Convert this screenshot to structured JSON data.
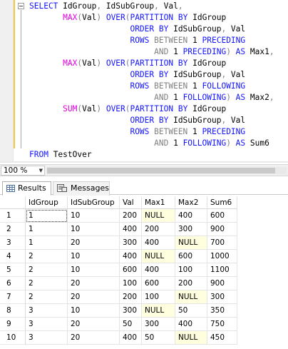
{
  "editor": {
    "lines": [
      [
        {
          "t": "SELECT ",
          "c": "kw"
        },
        {
          "t": "IdGroup",
          "c": "id"
        },
        {
          "t": ", ",
          "c": "op"
        },
        {
          "t": "IdSubGroup",
          "c": "id"
        },
        {
          "t": ", ",
          "c": "op"
        },
        {
          "t": "Val",
          "c": "id"
        },
        {
          "t": ",",
          "c": "op"
        }
      ],
      [
        {
          "t": "       ",
          "c": "id"
        },
        {
          "t": "MAX",
          "c": "fn"
        },
        {
          "t": "(",
          "c": "op"
        },
        {
          "t": "Val",
          "c": "id"
        },
        {
          "t": ") ",
          "c": "op"
        },
        {
          "t": "OVER",
          "c": "kw"
        },
        {
          "t": "(",
          "c": "op"
        },
        {
          "t": "PARTITION BY ",
          "c": "kw"
        },
        {
          "t": "IdGroup",
          "c": "id"
        }
      ],
      [
        {
          "t": "                     ",
          "c": "id"
        },
        {
          "t": "ORDER BY ",
          "c": "kw"
        },
        {
          "t": "IdSubGroup",
          "c": "id"
        },
        {
          "t": ", ",
          "c": "op"
        },
        {
          "t": "Val",
          "c": "id"
        }
      ],
      [
        {
          "t": "                     ",
          "c": "id"
        },
        {
          "t": "ROWS ",
          "c": "kw"
        },
        {
          "t": "BETWEEN ",
          "c": "op"
        },
        {
          "t": "1 ",
          "c": "lit"
        },
        {
          "t": "PRECEDING",
          "c": "kw"
        }
      ],
      [
        {
          "t": "                          ",
          "c": "id"
        },
        {
          "t": "AND ",
          "c": "op"
        },
        {
          "t": "1 ",
          "c": "lit"
        },
        {
          "t": "PRECEDING",
          "c": "kw"
        },
        {
          "t": ") ",
          "c": "op"
        },
        {
          "t": "AS ",
          "c": "kw"
        },
        {
          "t": "Max1",
          "c": "id"
        },
        {
          "t": ",",
          "c": "op"
        }
      ],
      [
        {
          "t": "       ",
          "c": "id"
        },
        {
          "t": "MAX",
          "c": "fn"
        },
        {
          "t": "(",
          "c": "op"
        },
        {
          "t": "Val",
          "c": "id"
        },
        {
          "t": ") ",
          "c": "op"
        },
        {
          "t": "OVER",
          "c": "kw"
        },
        {
          "t": "(",
          "c": "op"
        },
        {
          "t": "PARTITION BY ",
          "c": "kw"
        },
        {
          "t": "IdGroup",
          "c": "id"
        }
      ],
      [
        {
          "t": "                     ",
          "c": "id"
        },
        {
          "t": "ORDER BY ",
          "c": "kw"
        },
        {
          "t": "IdSubGroup",
          "c": "id"
        },
        {
          "t": ", ",
          "c": "op"
        },
        {
          "t": "Val",
          "c": "id"
        }
      ],
      [
        {
          "t": "                     ",
          "c": "id"
        },
        {
          "t": "ROWS ",
          "c": "kw"
        },
        {
          "t": "BETWEEN ",
          "c": "op"
        },
        {
          "t": "1 ",
          "c": "lit"
        },
        {
          "t": "FOLLOWING",
          "c": "kw"
        }
      ],
      [
        {
          "t": "                          ",
          "c": "id"
        },
        {
          "t": "AND ",
          "c": "op"
        },
        {
          "t": "1 ",
          "c": "lit"
        },
        {
          "t": "FOLLOWING",
          "c": "kw"
        },
        {
          "t": ") ",
          "c": "op"
        },
        {
          "t": "AS ",
          "c": "kw"
        },
        {
          "t": "Max2",
          "c": "id"
        },
        {
          "t": ",",
          "c": "op"
        }
      ],
      [
        {
          "t": "       ",
          "c": "id"
        },
        {
          "t": "SUM",
          "c": "fn"
        },
        {
          "t": "(",
          "c": "op"
        },
        {
          "t": "Val",
          "c": "id"
        },
        {
          "t": ") ",
          "c": "op"
        },
        {
          "t": "OVER",
          "c": "kw"
        },
        {
          "t": "(",
          "c": "op"
        },
        {
          "t": "PARTITION BY ",
          "c": "kw"
        },
        {
          "t": "IdGroup",
          "c": "id"
        }
      ],
      [
        {
          "t": "                     ",
          "c": "id"
        },
        {
          "t": "ORDER BY ",
          "c": "kw"
        },
        {
          "t": "IdSubGroup",
          "c": "id"
        },
        {
          "t": ", ",
          "c": "op"
        },
        {
          "t": "Val",
          "c": "id"
        }
      ],
      [
        {
          "t": "                     ",
          "c": "id"
        },
        {
          "t": "ROWS ",
          "c": "kw"
        },
        {
          "t": "BETWEEN ",
          "c": "op"
        },
        {
          "t": "1 ",
          "c": "lit"
        },
        {
          "t": "PRECEDING",
          "c": "kw"
        }
      ],
      [
        {
          "t": "                          ",
          "c": "id"
        },
        {
          "t": "AND ",
          "c": "op"
        },
        {
          "t": "1 ",
          "c": "lit"
        },
        {
          "t": "FOLLOWING",
          "c": "kw"
        },
        {
          "t": ") ",
          "c": "op"
        },
        {
          "t": "AS ",
          "c": "kw"
        },
        {
          "t": "Sum6",
          "c": "id"
        }
      ],
      [
        {
          "t": "FROM ",
          "c": "kw"
        },
        {
          "t": "TestOver",
          "c": "id"
        }
      ]
    ]
  },
  "zoom": {
    "value": "100 %"
  },
  "tabs": {
    "results_label": "Results",
    "messages_label": "Messages"
  },
  "grid": {
    "columns": [
      "IdGroup",
      "IdSubGroup",
      "Val",
      "Max1",
      "Max2",
      "Sum6"
    ],
    "rows": [
      {
        "n": "1",
        "cells": [
          "1",
          "10",
          "200",
          "NULL",
          "400",
          "600"
        ]
      },
      {
        "n": "2",
        "cells": [
          "1",
          "10",
          "400",
          "200",
          "300",
          "900"
        ]
      },
      {
        "n": "3",
        "cells": [
          "1",
          "20",
          "300",
          "400",
          "NULL",
          "700"
        ]
      },
      {
        "n": "4",
        "cells": [
          "2",
          "10",
          "400",
          "NULL",
          "600",
          "1000"
        ]
      },
      {
        "n": "5",
        "cells": [
          "2",
          "10",
          "600",
          "400",
          "100",
          "1100"
        ]
      },
      {
        "n": "6",
        "cells": [
          "2",
          "20",
          "100",
          "600",
          "200",
          "900"
        ]
      },
      {
        "n": "7",
        "cells": [
          "2",
          "20",
          "200",
          "100",
          "NULL",
          "300"
        ]
      },
      {
        "n": "8",
        "cells": [
          "3",
          "10",
          "300",
          "NULL",
          "50",
          "350"
        ]
      },
      {
        "n": "9",
        "cells": [
          "3",
          "20",
          "50",
          "300",
          "400",
          "750"
        ]
      },
      {
        "n": "10",
        "cells": [
          "3",
          "20",
          "400",
          "50",
          "NULL",
          "450"
        ]
      }
    ]
  }
}
